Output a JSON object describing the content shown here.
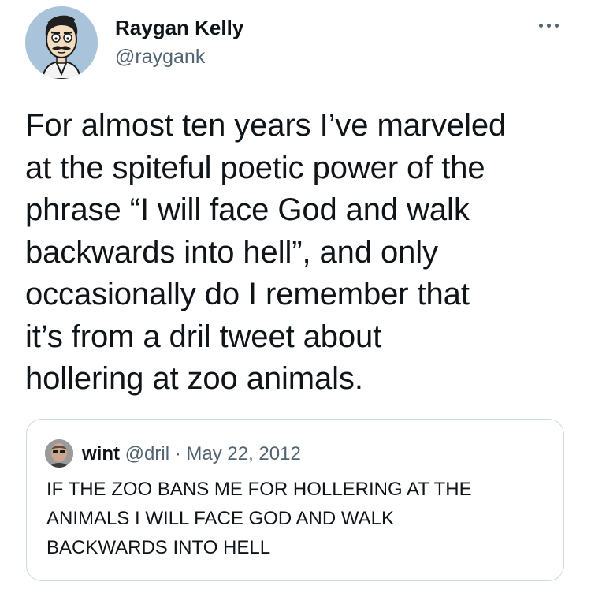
{
  "tweet": {
    "author": {
      "name": "Raygan Kelly",
      "handle": "@raygank"
    },
    "text_lines": [
      "For almost ten years I’ve marveled",
      "at the spiteful poetic power of the",
      "phrase “I will face God and walk",
      "backwards into hell”, and only",
      "occasionally do I remember that",
      "it’s from a dril tweet about",
      "hollering at zoo animals."
    ],
    "more_icon": "more-horizontal-icon"
  },
  "quoted_tweet": {
    "name": "wint",
    "handle": "@dril",
    "separator": " · ",
    "date": "May 22, 2012",
    "text_lines": [
      "IF THE ZOO BANS ME FOR HOLLERING AT THE",
      "ANIMALS I WILL FACE GOD AND WALK",
      "BACKWARDS INTO HELL"
    ]
  },
  "colors": {
    "text": "#0f1419",
    "secondary_text": "#536471",
    "border": "#cfd9de",
    "avatar_bg": "#a9c4da"
  }
}
